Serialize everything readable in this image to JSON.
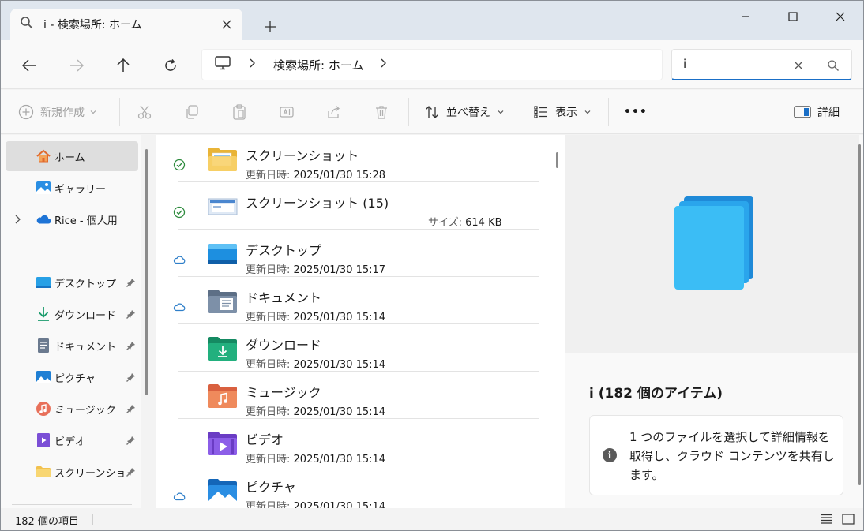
{
  "tab": {
    "title": "i - 検索場所: ホーム",
    "icon": "search-icon"
  },
  "address": {
    "crumb": "検索場所: ホーム"
  },
  "search": {
    "value": "i"
  },
  "commands": {
    "new": "新規作成",
    "sort": "並べ替え",
    "view": "表示",
    "more": "•••",
    "details": "詳細"
  },
  "sidebar": {
    "items": [
      {
        "label": "ホーム",
        "icon": "home-icon"
      },
      {
        "label": "ギャラリー",
        "icon": "gallery-icon"
      },
      {
        "label": "Rice - 個人用",
        "icon": "onedrive-icon"
      },
      {
        "label": "デスクトップ",
        "icon": "desktop-icon"
      },
      {
        "label": "ダウンロード",
        "icon": "download-icon"
      },
      {
        "label": "ドキュメント",
        "icon": "document-icon"
      },
      {
        "label": "ピクチャ",
        "icon": "pictures-icon"
      },
      {
        "label": "ミュージック",
        "icon": "music-icon"
      },
      {
        "label": "ビデオ",
        "icon": "video-icon"
      },
      {
        "label": "スクリーンショット",
        "icon": "folder-icon"
      }
    ]
  },
  "files": {
    "meta_label": "更新日時:",
    "size_label": "サイズ:",
    "rows": [
      {
        "name": "スクリーンショット",
        "date": "2025/01/30 15:28",
        "status": "synced"
      },
      {
        "name": "スクリーンショット (15)",
        "size": "614 KB",
        "status": "synced"
      },
      {
        "name": "デスクトップ",
        "date": "2025/01/30 15:17",
        "status": "cloud"
      },
      {
        "name": "ドキュメント",
        "date": "2025/01/30 15:14",
        "status": "cloud"
      },
      {
        "name": "ダウンロード",
        "date": "2025/01/30 15:14",
        "status": ""
      },
      {
        "name": "ミュージック",
        "date": "2025/01/30 15:14",
        "status": ""
      },
      {
        "name": "ビデオ",
        "date": "2025/01/30 15:14",
        "status": ""
      },
      {
        "name": "ピクチャ",
        "date": "2025/01/30 15:14",
        "status": "cloud"
      }
    ]
  },
  "details": {
    "title": "i (182 個のアイテム)",
    "info": "1 つのファイルを選択して詳細情報を取得し、クラウド コンテンツを共有します。"
  },
  "status": {
    "count": "182 個の項目"
  },
  "colors": {
    "accent": "#1a6fc7",
    "sync_green": "#2e8b3e",
    "cloud_blue": "#2f7fc9"
  }
}
